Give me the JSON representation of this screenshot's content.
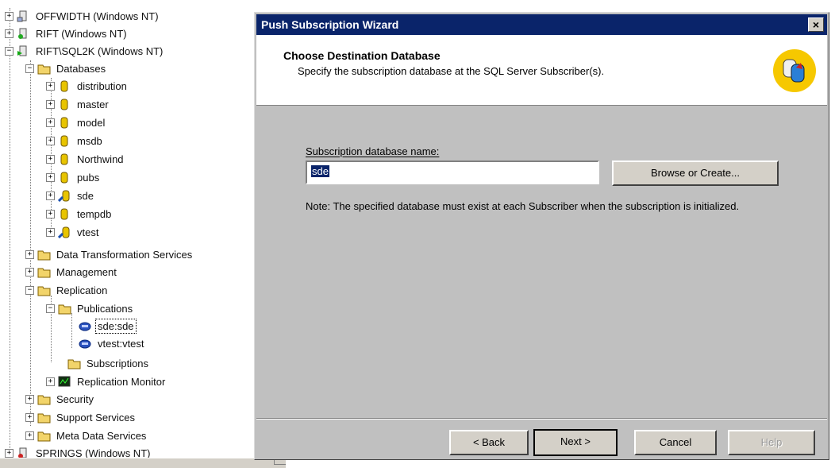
{
  "tree": {
    "servers": [
      {
        "label": "OFFWIDTH (Windows NT)"
      },
      {
        "label": "RIFT (Windows NT)"
      },
      {
        "label": "RIFT\\SQL2K (Windows NT)"
      }
    ],
    "databases_label": "Databases",
    "databases": [
      "distribution",
      "master",
      "model",
      "msdb",
      "Northwind",
      "pubs",
      "sde",
      "tempdb",
      "vtest"
    ],
    "dts_label": "Data Transformation Services",
    "management_label": "Management",
    "replication_label": "Replication",
    "publications_label": "Publications",
    "publications": [
      "sde:sde",
      "vtest:vtest"
    ],
    "subscriptions_label": "Subscriptions",
    "replication_monitor_label": "Replication Monitor",
    "security_label": "Security",
    "support_services_label": "Support Services",
    "meta_data_services_label": "Meta Data Services",
    "springs_label": "SPRINGS (Windows NT)"
  },
  "dialog": {
    "title": "Push Subscription Wizard",
    "close_glyph": "×",
    "header_title": "Choose Destination Database",
    "header_subtitle": "Specify the subscription database at the SQL Server Subscriber(s).",
    "field_label": "Subscription database name:",
    "field_value": "sde",
    "browse_label": "Browse or Create...",
    "note": "Note: The specified database must exist at each Subscriber when the subscription is initialized.",
    "back_label": "< Back",
    "next_label": "Next >",
    "cancel_label": "Cancel",
    "help_label": "Help"
  },
  "colors": {
    "titlebar": "#0a246a",
    "dialog_face": "#c0c0c0",
    "folder": "#f2d46a",
    "icon_circle": "#f6c800"
  }
}
